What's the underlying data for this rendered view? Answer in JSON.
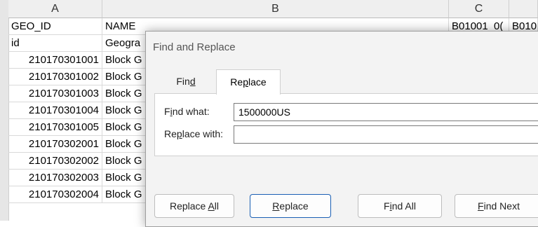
{
  "sheet": {
    "columns": [
      "A",
      "B",
      "C"
    ],
    "header_row": [
      "GEO_ID",
      "NAME",
      "B01001_0(",
      "B010"
    ],
    "id_row": [
      "id",
      "Geogra"
    ],
    "rows": [
      [
        "210170301001",
        "Block G"
      ],
      [
        "210170301002",
        "Block G"
      ],
      [
        "210170301003",
        "Block G"
      ],
      [
        "210170301004",
        "Block G"
      ],
      [
        "210170301005",
        "Block G"
      ],
      [
        "210170302001",
        "Block G"
      ],
      [
        "210170302002",
        "Block G"
      ],
      [
        "210170302003",
        "Block G"
      ],
      [
        "210170302004",
        "Block G"
      ]
    ]
  },
  "dialog": {
    "title": "Find and Replace",
    "tabs": {
      "find_pre": "Fin",
      "find_ul": "d",
      "find_post": "",
      "replace_pre": "Re",
      "replace_ul": "p",
      "replace_post": "lace"
    },
    "find_label": {
      "pre": "F",
      "ul": "i",
      "post": "nd what:"
    },
    "find_value": "1500000US",
    "replace_label": {
      "pre": "Re",
      "ul": "p",
      "post": "lace with:"
    },
    "replace_value": "",
    "buttons": {
      "replace_all": {
        "pre": "Replace ",
        "ul": "A",
        "post": "ll"
      },
      "replace": {
        "pre": "",
        "ul": "R",
        "post": "eplace"
      },
      "find_all": {
        "pre": "F",
        "ul": "i",
        "post": "nd All"
      },
      "find_next": {
        "pre": "",
        "ul": "F",
        "post": "ind Next"
      }
    }
  }
}
